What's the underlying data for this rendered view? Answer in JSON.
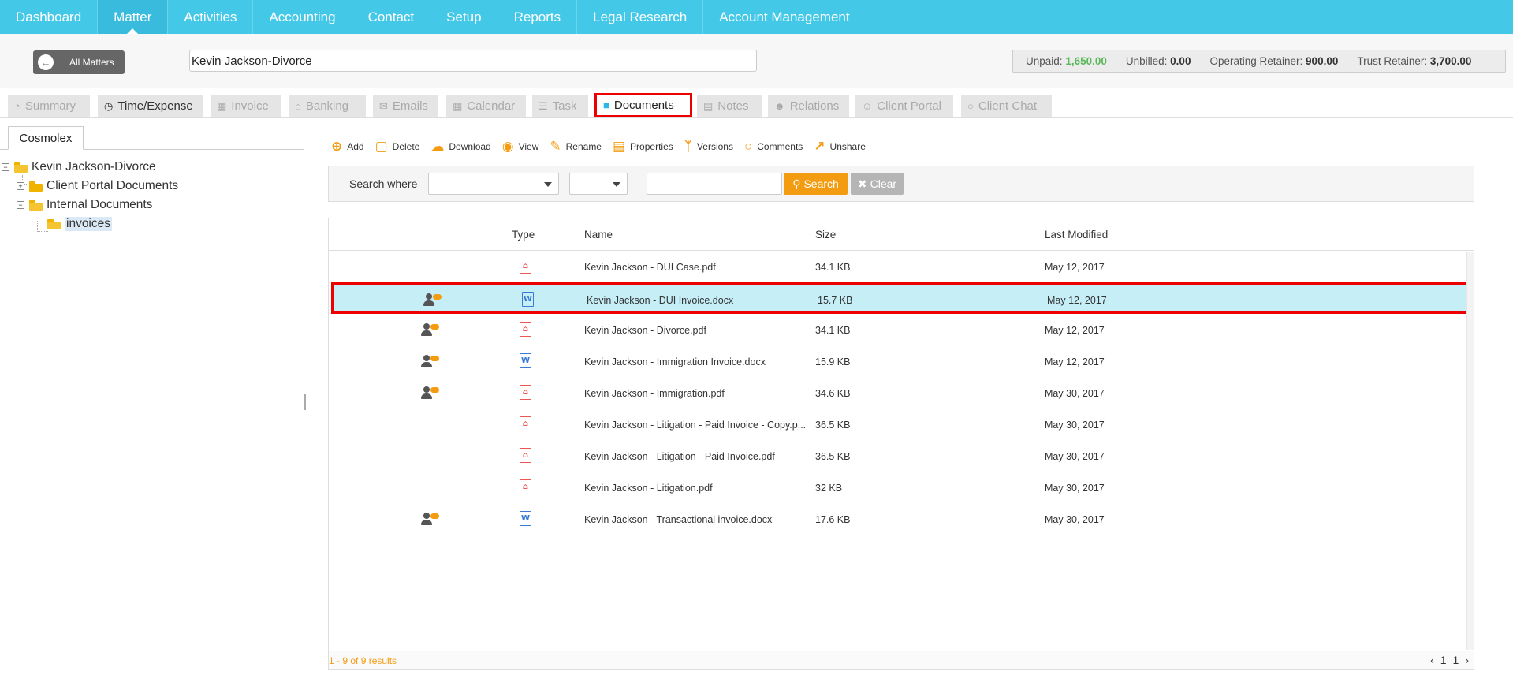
{
  "nav": {
    "items": [
      "Dashboard",
      "Matter",
      "Activities",
      "Accounting",
      "Contact",
      "Setup",
      "Reports",
      "Legal Research",
      "Account Management"
    ],
    "active": "Matter"
  },
  "matter": {
    "all_matters_label": "All Matters",
    "name": "Kevin Jackson-Divorce"
  },
  "balances": {
    "unpaid_label": "Unpaid:",
    "unpaid_value": "1,650.00",
    "unbilled_label": "Unbilled:",
    "unbilled_value": "0.00",
    "operating_label": "Operating Retainer:",
    "operating_value": "900.00",
    "trust_label": "Trust Retainer:",
    "trust_value": "3,700.00"
  },
  "subtabs": {
    "summary": "Summary",
    "time_expense": "Time/Expense",
    "invoice": "Invoice",
    "banking": "Banking",
    "emails": "Emails",
    "calendar": "Calendar",
    "task": "Task",
    "documents": "Documents",
    "notes": "Notes",
    "relations": "Relations",
    "client_portal": "Client Portal",
    "client_chat": "Client Chat"
  },
  "tree": {
    "tab": "Cosmolex",
    "root": "Kevin Jackson-Divorce",
    "client_portal": "Client Portal Documents",
    "internal": "Internal Documents",
    "invoices": "invoices"
  },
  "toolbar": {
    "add": "Add",
    "delete": "Delete",
    "download": "Download",
    "view": "View",
    "rename": "Rename",
    "properties": "Properties",
    "versions": "Versions",
    "comments": "Comments",
    "unshare": "Unshare"
  },
  "search": {
    "label": "Search where",
    "search_btn": "Search",
    "clear_btn": "Clear"
  },
  "grid": {
    "headers": {
      "type": "Type",
      "name": "Name",
      "size": "Size",
      "modified": "Last Modified"
    },
    "rows": [
      {
        "shared": false,
        "type": "pdf",
        "name": "Kevin Jackson - DUI Case.pdf",
        "size": "34.1 KB",
        "modified": "May 12, 2017"
      },
      {
        "shared": true,
        "type": "doc",
        "name": "Kevin Jackson - DUI Invoice.docx",
        "size": "15.7 KB",
        "modified": "May 12, 2017"
      },
      {
        "shared": true,
        "type": "pdf",
        "name": "Kevin Jackson - Divorce.pdf",
        "size": "34.1 KB",
        "modified": "May 12, 2017"
      },
      {
        "shared": true,
        "type": "doc",
        "name": "Kevin Jackson - Immigration Invoice.docx",
        "size": "15.9 KB",
        "modified": "May 12, 2017"
      },
      {
        "shared": true,
        "type": "pdf",
        "name": "Kevin Jackson - Immigration.pdf",
        "size": "34.6 KB",
        "modified": "May 30, 2017"
      },
      {
        "shared": false,
        "type": "pdf",
        "name": "Kevin Jackson - Litigation - Paid Invoice - Copy.p...",
        "size": "36.5 KB",
        "modified": "May 30, 2017"
      },
      {
        "shared": false,
        "type": "pdf",
        "name": "Kevin Jackson - Litigation - Paid Invoice.pdf",
        "size": "36.5 KB",
        "modified": "May 30, 2017"
      },
      {
        "shared": false,
        "type": "pdf",
        "name": "Kevin Jackson - Litigation.pdf",
        "size": "32 KB",
        "modified": "May 30, 2017"
      },
      {
        "shared": true,
        "type": "doc",
        "name": "Kevin Jackson - Transactional invoice.docx",
        "size": "17.6 KB",
        "modified": "May 30, 2017"
      }
    ],
    "selected_index": 1
  },
  "footer": {
    "results": "1 - 9 of 9 results",
    "page_a": "1",
    "page_b": "1"
  }
}
